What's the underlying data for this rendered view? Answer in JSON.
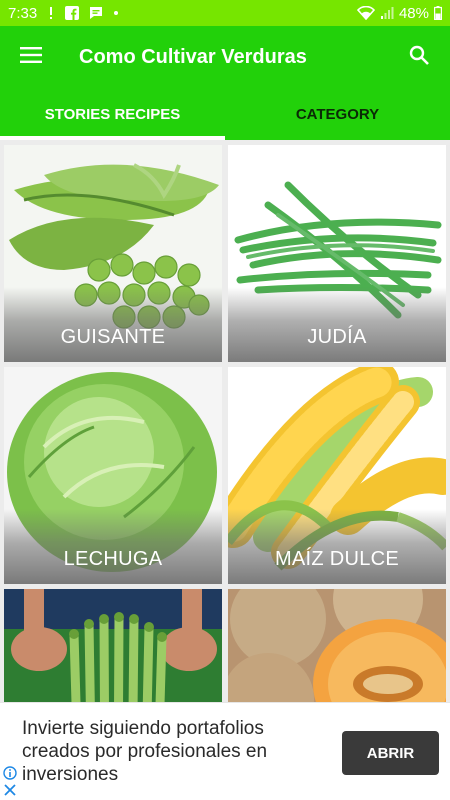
{
  "status_bar": {
    "time": "7:33",
    "battery": "48%",
    "icons": [
      "notification-icon",
      "facebook-icon",
      "message-icon",
      "dot-icon",
      "wifi-icon",
      "signal-icon",
      "battery-icon"
    ]
  },
  "app_bar": {
    "title": "Como Cultivar Verduras",
    "menu_icon": "menu-icon",
    "search_icon": "search-icon",
    "color": "#22d10a"
  },
  "tabs": [
    {
      "label": "STORIES RECIPES",
      "active": true
    },
    {
      "label": "CATEGORY",
      "active": false
    }
  ],
  "grid": {
    "items": [
      {
        "label": "GUISANTE"
      },
      {
        "label": "JUDÍA"
      },
      {
        "label": "LECHUGA"
      },
      {
        "label": "MAÍZ DULCE"
      },
      {
        "label": ""
      },
      {
        "label": ""
      }
    ]
  },
  "ad": {
    "text": "Invierte siguiendo portafolios creados por profesionales en inversiones",
    "button_label": "ABRIR",
    "info_icon": "info-icon",
    "close_icon": "close-icon"
  },
  "colors": {
    "status_bar": "#76e600",
    "app_bar": "#22d10a",
    "ad_button": "#3a3a3a"
  }
}
